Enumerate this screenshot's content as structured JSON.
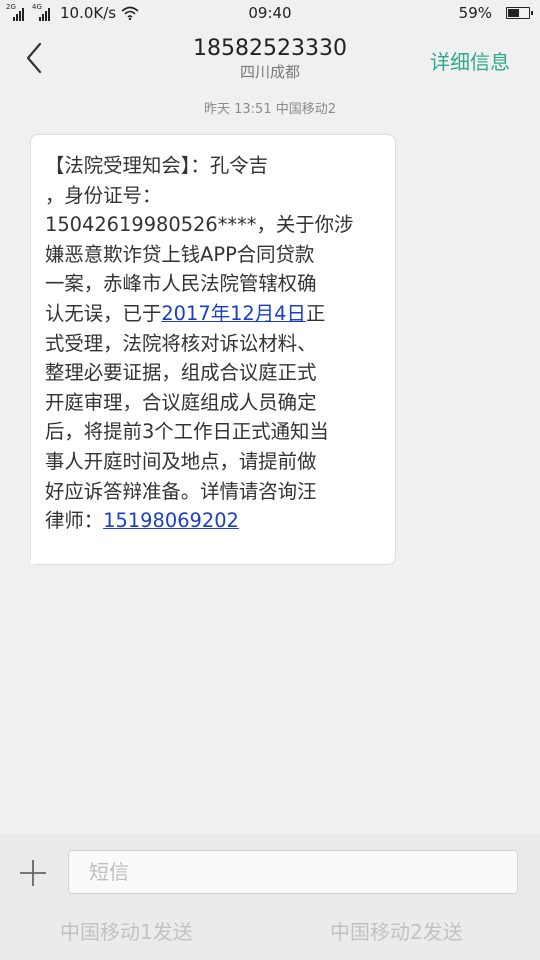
{
  "status_bar": {
    "network_1": "2G",
    "network_2": "4G",
    "speed": "10.0K/s",
    "time": "09:40",
    "battery_text": "59%",
    "battery_level": 0.59
  },
  "header": {
    "phone_number": "18582523330",
    "location": "四川成都",
    "details_label": "详细信息"
  },
  "conversation": {
    "timestamp": "昨天  13:51  中国移动2",
    "message": {
      "lines": [
        "【法院受理知会】：孔令吉",
        "，身份证号：",
        "15042619980526****，关于你涉",
        "嫌恶意欺诈贷上钱APP合同贷款",
        "一案，赤峰市人民法院管辖权确"
      ],
      "line6_before": "认无误，已于",
      "date_link": "2017年12月4日",
      "line6_after": "正",
      "lines_mid": [
        "式受理，法院将核对诉讼材料、",
        "整理必要证据，组成合议庭正式",
        "开庭审理，合议庭组成人员确定",
        "后，将提前3个工作日正式通知当",
        "事人开庭时间及地点，请提前做",
        "好应诉答辩准备。详情请咨询汪"
      ],
      "last_line_before": "律师：",
      "phone_link": "15198069202"
    }
  },
  "composer": {
    "input_placeholder": "短信",
    "send_sim1": "中国移动1发送",
    "send_sim2": "中国移动2发送"
  },
  "colors": {
    "accent": "#2fa98e",
    "link": "#1a3ec8",
    "background": "#f0f0f0"
  },
  "icons": {
    "back": "chevron-left-icon",
    "plus": "plus-icon",
    "wifi": "wifi-icon",
    "battery": "battery-icon",
    "signal": "signal-icon"
  }
}
